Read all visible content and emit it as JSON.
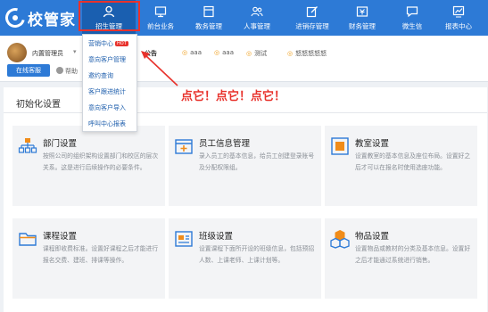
{
  "app": {
    "logo_text": "校管家"
  },
  "nav": [
    {
      "label": "招生管理",
      "icon": "person-icon"
    },
    {
      "label": "前台业务",
      "icon": "monitor-icon"
    },
    {
      "label": "教务管理",
      "icon": "book-icon"
    },
    {
      "label": "人事管理",
      "icon": "people-icon"
    },
    {
      "label": "进销存管理",
      "icon": "edit-icon"
    },
    {
      "label": "财务管理",
      "icon": "money-icon"
    },
    {
      "label": "微生信",
      "icon": "chat-icon"
    },
    {
      "label": "报表中心",
      "icon": "chart-icon"
    }
  ],
  "user": {
    "name": "内置管理员",
    "caret": "▾",
    "online_label": "在线客服",
    "help_label": "帮助"
  },
  "notices": {
    "label": "公告",
    "items": [
      "aaa",
      "aaa",
      "测试",
      "怒怒怒怒怒"
    ]
  },
  "dropdown": {
    "hot_badge": "HOT",
    "items": [
      "营销中心",
      "意向客户管理",
      "邀约查询",
      "客户跟进统计",
      "意向客户导入",
      "呼叫中心报表"
    ]
  },
  "callout": "点它！点它！点它！",
  "panel": {
    "title": "初始化设置"
  },
  "cards": [
    {
      "title": "部门设置",
      "desc": "按照公司的组织架构设置部门和校区的层次关系。这是进行后续操作的必要条件。",
      "icon": "org-chart-icon"
    },
    {
      "title": "员工信息管理",
      "desc": "录入员工的基本信息，给员工创建登录账号及分配权限组。",
      "icon": "employee-icon"
    },
    {
      "title": "教室设置",
      "desc": "设置教室的基本信息及座位布局。设置好之后才可以在报名时使用选座功能。",
      "icon": "classroom-icon"
    },
    {
      "title": "课程设置",
      "desc": "课程即收费标准。设置好课程之后才能进行报名交费、建班、排课等操作。",
      "icon": "folder-icon"
    },
    {
      "title": "班级设置",
      "desc": "设置课程下面所开设的班级信息，包括预招人数、上课老师、上课计划等。",
      "icon": "class-icon"
    },
    {
      "title": "物品设置",
      "desc": "设置物品或教材的分类及基本信息。设置好之后才能通过系统进行销售。",
      "icon": "boxes-icon"
    }
  ],
  "colors": {
    "brand": "#2d7ad6",
    "accent_red": "#e8322c",
    "orange": "#f08c1a"
  }
}
